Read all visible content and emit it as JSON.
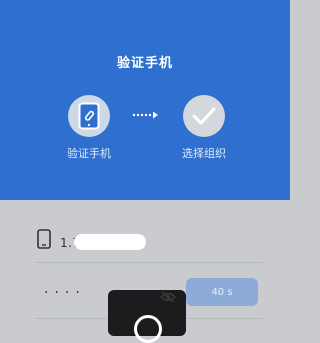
{
  "header": {
    "title": "验证手机",
    "steps": [
      {
        "label": "验证手机",
        "icon": "phone-link-icon",
        "state": "current"
      },
      {
        "label": "选择组织",
        "icon": "check-icon",
        "state": "pending"
      }
    ],
    "colors": {
      "background": "#2e6fcf"
    }
  },
  "form": {
    "phone_icon": "mobile-phone-icon",
    "phone_number_visible": "1.7/0…",
    "code_mask": "····",
    "countdown_label": "40 s",
    "eye_icon": "eye-hidden-icon"
  }
}
